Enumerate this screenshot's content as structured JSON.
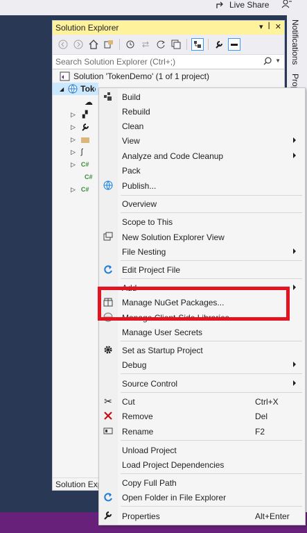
{
  "topbar": {
    "live_share": "Live Share"
  },
  "panel": {
    "title": "Solution Explorer",
    "search_placeholder": "Search Solution Explorer (Ctrl+;)",
    "solution_label": "Solution 'TokenDemo' (1 of 1 project)",
    "project_label": "TokenDemo.Web",
    "bottom_label": "Solution Explorer"
  },
  "right_tabs": {
    "notifications": "Notifications",
    "properties": "Properties"
  },
  "menu": {
    "items": [
      {
        "label": "Build",
        "icon": "build-icon"
      },
      {
        "label": "Rebuild"
      },
      {
        "label": "Clean"
      },
      {
        "label": "View",
        "submenu": true
      },
      {
        "label": "Analyze and Code Cleanup",
        "submenu": true
      },
      {
        "label": "Pack"
      },
      {
        "label": "Publish...",
        "icon": "globe-icon"
      },
      {
        "label": "Overview"
      },
      {
        "label": "Scope to This"
      },
      {
        "label": "New Solution Explorer View",
        "icon": "new-view-icon"
      },
      {
        "label": "File Nesting",
        "submenu": true
      },
      {
        "label": "Edit Project File",
        "icon": "edit-project-icon"
      },
      {
        "label": "Add",
        "submenu": true
      },
      {
        "label": "Manage NuGet Packages...",
        "icon": "nuget-icon"
      },
      {
        "label": "Manage Client-Side Libraries...",
        "icon": "globe-icon"
      },
      {
        "label": "Manage User Secrets"
      },
      {
        "label": "Set as Startup Project",
        "icon": "gear-icon"
      },
      {
        "label": "Debug",
        "submenu": true
      },
      {
        "label": "Source Control",
        "submenu": true
      },
      {
        "label": "Cut",
        "shortcut": "Ctrl+X",
        "icon": "scissors-icon"
      },
      {
        "label": "Remove",
        "shortcut": "Del",
        "icon": "remove-icon"
      },
      {
        "label": "Rename",
        "shortcut": "F2",
        "icon": "rename-icon"
      },
      {
        "label": "Unload Project"
      },
      {
        "label": "Load Project Dependencies"
      },
      {
        "label": "Copy Full Path"
      },
      {
        "label": "Open Folder in File Explorer",
        "icon": "open-folder-icon"
      },
      {
        "label": "Properties",
        "shortcut": "Alt+Enter",
        "icon": "wrench-icon"
      }
    ]
  },
  "colors": {
    "background": "#293955",
    "title_highlight": "#fff29d",
    "annotation_red": "#e3141f",
    "status_bar": "#68217a"
  }
}
